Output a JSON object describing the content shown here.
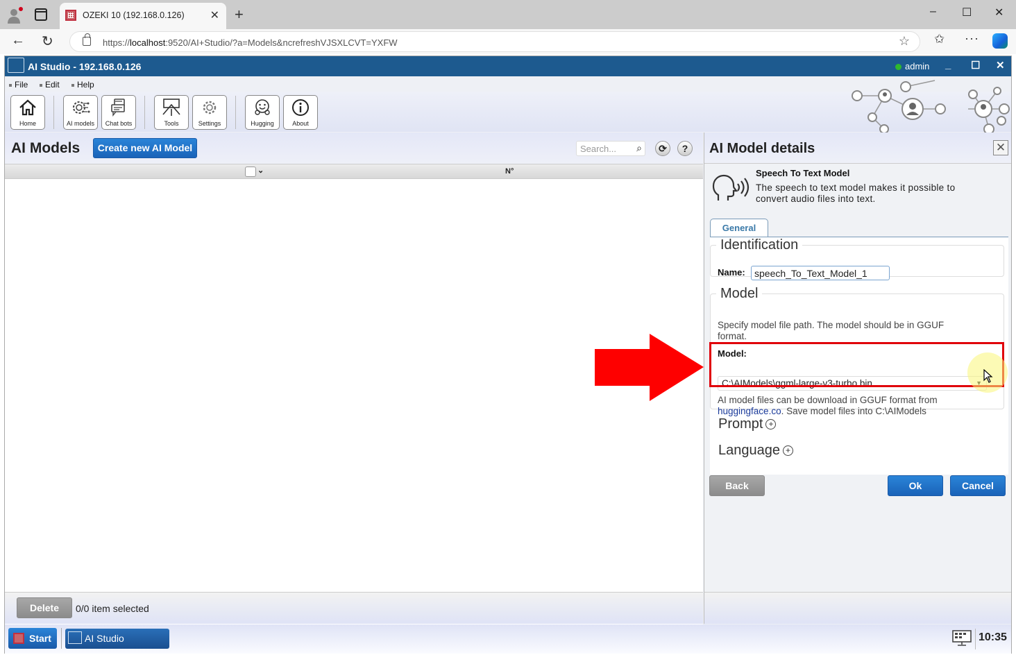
{
  "browser": {
    "tab_title": "OZEKI 10 (192.168.0.126)",
    "url_prefix": "https://",
    "url_host": "localhost",
    "url_rest": ":9520/AI+Studio/?a=Models&ncrefreshVJSXLCVT=YXFW",
    "window_controls": {
      "minimize": "–",
      "maximize": "☐",
      "close": "✕"
    }
  },
  "app": {
    "title": "AI Studio - 192.168.0.126",
    "user": "admin",
    "user_status_color": "#2eb82e",
    "title_controls": {
      "minimize": "_",
      "maximize": "☐",
      "close": "✕"
    },
    "menu": [
      "File",
      "Edit",
      "Help"
    ],
    "toolbar": [
      {
        "label": "Home",
        "icon": "home-icon"
      },
      {
        "label": "AI models",
        "icon": "ai-models-icon"
      },
      {
        "label": "Chat bots",
        "icon": "chat-bots-icon"
      },
      {
        "label": "Tools",
        "icon": "tools-icon"
      },
      {
        "label": "Settings",
        "icon": "settings-icon"
      },
      {
        "label": "Hugging",
        "icon": "hugging-face-icon"
      },
      {
        "label": "About",
        "icon": "info-icon"
      }
    ]
  },
  "left_panel": {
    "title": "AI Models",
    "create_button": "Create new AI Model",
    "search_placeholder": "Search...",
    "columns": {
      "number": "N°"
    },
    "delete_button": "Delete",
    "selection_status": "0/0 item selected"
  },
  "details": {
    "title": "AI Model details",
    "model_type_title": "Speech To Text Model",
    "model_type_desc": "The speech to text model makes it possible to convert audio files into text.",
    "tabs": [
      "General"
    ],
    "identification": {
      "legend": "Identification",
      "name_label": "Name:",
      "name_value": "speech_To_Text_Model_1"
    },
    "model": {
      "legend": "Model",
      "hint": "Specify model file path. The model should be in GGUF format.",
      "field_label": "Model:",
      "selected_value": "C:\\AIModels\\ggml-large-v3-turbo.bin",
      "note_prefix": "AI model files can be download in GGUF format from",
      "note_link": "huggingface.co",
      "note_suffix": ". Save model files into C:\\AIModels"
    },
    "expanders": [
      "Prompt",
      "Language"
    ],
    "buttons": {
      "back": "Back",
      "ok": "Ok",
      "cancel": "Cancel"
    }
  },
  "taskbar": {
    "start": "Start",
    "app": "AI Studio",
    "clock": "10:35"
  },
  "annotation": {
    "highlight_color": "#e0000a"
  }
}
